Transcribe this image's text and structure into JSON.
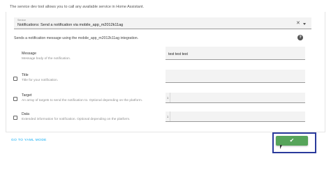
{
  "intro_text": "The service dev tool allows you to call any available service in Home Assistant.",
  "service": {
    "label": "Service",
    "value": "Notifications: Send a notification via mobile_app_m2012k11ag",
    "clear_icon": "close-icon",
    "dropdown_icon": "chevron-down-icon"
  },
  "description": "Sends a notification message using the mobile_app_m2012k11ag integration.",
  "help_icon": "help-circle-icon",
  "fields": [
    {
      "title": "Message",
      "subtitle": "Message body of the notification.",
      "value": "test test test",
      "has_checkbox": false
    },
    {
      "title": "Title",
      "subtitle": "Title for your notification.",
      "value": "",
      "has_checkbox": true
    },
    {
      "title": "Target",
      "subtitle": "An array of targets to send the notification to.  Optional depending on the platform.",
      "line_number": "1",
      "has_checkbox": true
    },
    {
      "title": "Data",
      "subtitle": "Extended information for notification. Optional depending on the platform.",
      "line_number": "1",
      "has_checkbox": true
    }
  ],
  "footer": {
    "yaml_link": "GO TO YAML MODE",
    "call_button_icon": "checkmark-icon",
    "call_button_color": "#56a45a",
    "highlight_color": "#2a3a9b"
  }
}
